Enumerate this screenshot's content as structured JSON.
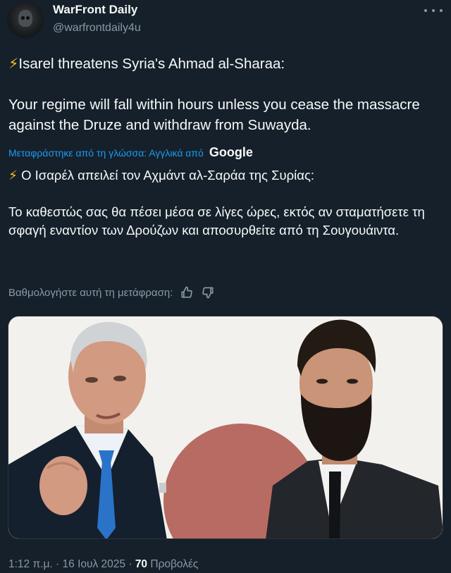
{
  "author": {
    "display_name": "WarFront Daily",
    "handle": "@warfrontdaily4u"
  },
  "tweet": {
    "bolt": "⚡",
    "headline": "Isarel threatens Syria's Ahmad al-Sharaa:",
    "body": "Your regime will fall within hours unless you cease the massacre against the Druze and withdraw from Suwayda."
  },
  "translation": {
    "label": "Μεταφράστηκε από τη γλώσσα: Αγγλικά από",
    "provider": "Google",
    "headline": "Ο Ισαρέλ απειλεί τον Αχμάντ αλ-Σαράα της Συρίας:",
    "body": "Το καθεστώς σας θα πέσει μέσα σε λίγες ώρες, εκτός αν σταματήσετε τη σφαγή εναντίον των Δρούζων και αποσυρθείτε από τη Σουγουάιντα.",
    "rate_prompt": "Βαθμολογήστε αυτή τη μετάφραση:"
  },
  "meta": {
    "time": "1:12 π.μ.",
    "separator": "·",
    "date": "16 Ιουλ 2025",
    "views_count": "70",
    "views_label": "Προβολές"
  },
  "icons": {
    "more": "more-dots-icon",
    "thumbs_up": "thumbs-up-icon",
    "thumbs_down": "thumbs-down-icon"
  },
  "colors": {
    "background": "#15202b",
    "link": "#1d9bf0",
    "muted": "#8b98a5"
  }
}
